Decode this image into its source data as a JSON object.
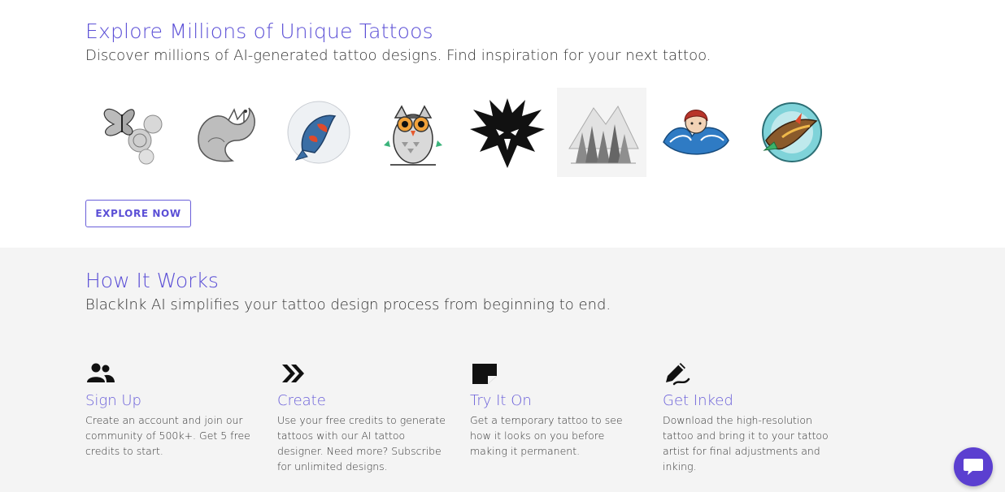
{
  "explore": {
    "title": "Explore Millions of Unique Tattoos",
    "subtitle": "Discover millions of AI-generated tattoo designs. Find inspiration for your next tattoo.",
    "thumbnails": [
      {
        "icon": "butterfly-roses-icon"
      },
      {
        "icon": "dragon-icon"
      },
      {
        "icon": "koi-fish-icon"
      },
      {
        "icon": "owl-icon"
      },
      {
        "icon": "eagle-head-icon"
      },
      {
        "icon": "forest-mountains-icon"
      },
      {
        "icon": "mermaid-wave-icon"
      },
      {
        "icon": "bird-circle-icon"
      }
    ],
    "button_label": "EXPLORE NOW"
  },
  "how_it_works": {
    "title": "How It Works",
    "subtitle": "BlackInk AI simplifies your tattoo design process from beginning to end.",
    "steps": [
      {
        "icon": "users-icon",
        "title": "Sign Up",
        "description": "Create an account and join our community of 500k+. Get 5 free credits to start."
      },
      {
        "icon": "double-chevron-icon",
        "title": "Create",
        "description": "Use your free credits to generate tattoos with our AI tattoo designer. Need more? Subscribe for unlimited designs."
      },
      {
        "icon": "note-icon",
        "title": "Try It On",
        "description": "Get a temporary tattoo to see how it looks on you before making it permanent."
      },
      {
        "icon": "pen-icon",
        "title": "Get Inked",
        "description": "Download the high-resolution tattoo and bring it to your tattoo artist for final adjustments and inking."
      }
    ]
  },
  "chat": {
    "icon": "chat-bubble-icon"
  },
  "colors": {
    "accent": "#5b4fd6",
    "section_bg": "#f4f4f4",
    "chat_bg": "#5b3fd0"
  }
}
